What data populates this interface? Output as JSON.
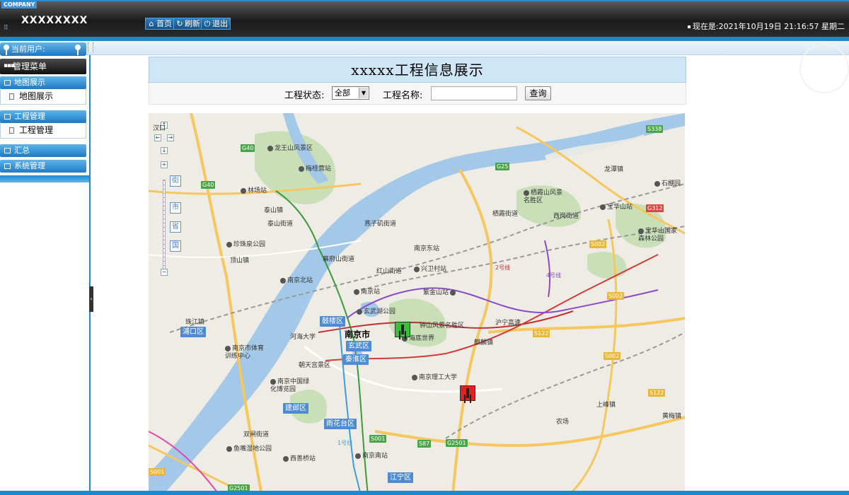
{
  "header": {
    "company": "COMPANY",
    "app_title": "XXXXXXXX",
    "nav": [
      {
        "icon": "home-icon",
        "label": "首页"
      },
      {
        "icon": "refresh-icon",
        "label": "刷新"
      },
      {
        "icon": "power-icon",
        "label": "退出"
      }
    ],
    "clock": "现在是:2021年10月19日 21:16:57 星期二"
  },
  "sidebar": {
    "current_user_label": "当前用户:",
    "menu_header": "管理菜单",
    "sections": [
      {
        "label": "地图展示",
        "items": [
          "地图展示"
        ]
      },
      {
        "label": "工程管理",
        "items": [
          "工程管理"
        ]
      },
      {
        "label": "汇总",
        "items": []
      },
      {
        "label": "系统管理",
        "items": []
      }
    ]
  },
  "main": {
    "title": "xxxxx工程信息展示",
    "filter": {
      "status_label": "工程状态:",
      "status_value": "全部",
      "name_label": "工程名称:",
      "name_value": "",
      "query_button": "查询"
    }
  },
  "map": {
    "city": "南京市",
    "districts": [
      "鼓楼区",
      "玄武区",
      "秦淮区",
      "建邺区",
      "雨花台区",
      "浦口区",
      "江宁区"
    ],
    "places": [
      "龙王山风景区",
      "梅桂营站",
      "林场站",
      "泰山镇",
      "泰山街道",
      "燕子矶街道",
      "珍珠泉公园",
      "顶山镇",
      "幕府山街道",
      "南京东站",
      "兴卫村站",
      "红山街道",
      "南京北站",
      "南京站",
      "紫金山站",
      "玄武湖公园",
      "钟山风景名胜区",
      "海底世界",
      "河海大学",
      "南京市体育训练中心",
      "朝天宫景区",
      "南京理工大学",
      "南京中国绿化博览园",
      "麒麟镇",
      "栖霞山风景名胜区",
      "栖霞街道",
      "西岗街道",
      "宝华山站",
      "宝华山国家森林公园",
      "龙潭镇",
      "石棚园",
      "上峰镇",
      "农场",
      "黄梅镇",
      "双闸街道",
      "鱼嘴湿地公园",
      "西善桥站",
      "南京南站",
      "珠江镇",
      "汉口",
      "沪宁高速"
    ],
    "roads": [
      "G40",
      "G40",
      "G25",
      "S338",
      "G312",
      "S002",
      "S002",
      "S122",
      "S002",
      "S122",
      "S001",
      "S87",
      "G2501",
      "G2501",
      "S001"
    ],
    "metro": [
      "1号线",
      "2号线",
      "4号线"
    ],
    "zoom_levels": [
      "街",
      "市",
      "省",
      "国"
    ],
    "markers": [
      {
        "status": "active",
        "color": "#39c13a"
      },
      {
        "status": "stopped",
        "color": "#e22222"
      }
    ],
    "colors": {
      "water": "#a3c8e8",
      "green": "#c8dfb8",
      "road": "#f6c75e",
      "land": "#eeece4"
    }
  }
}
